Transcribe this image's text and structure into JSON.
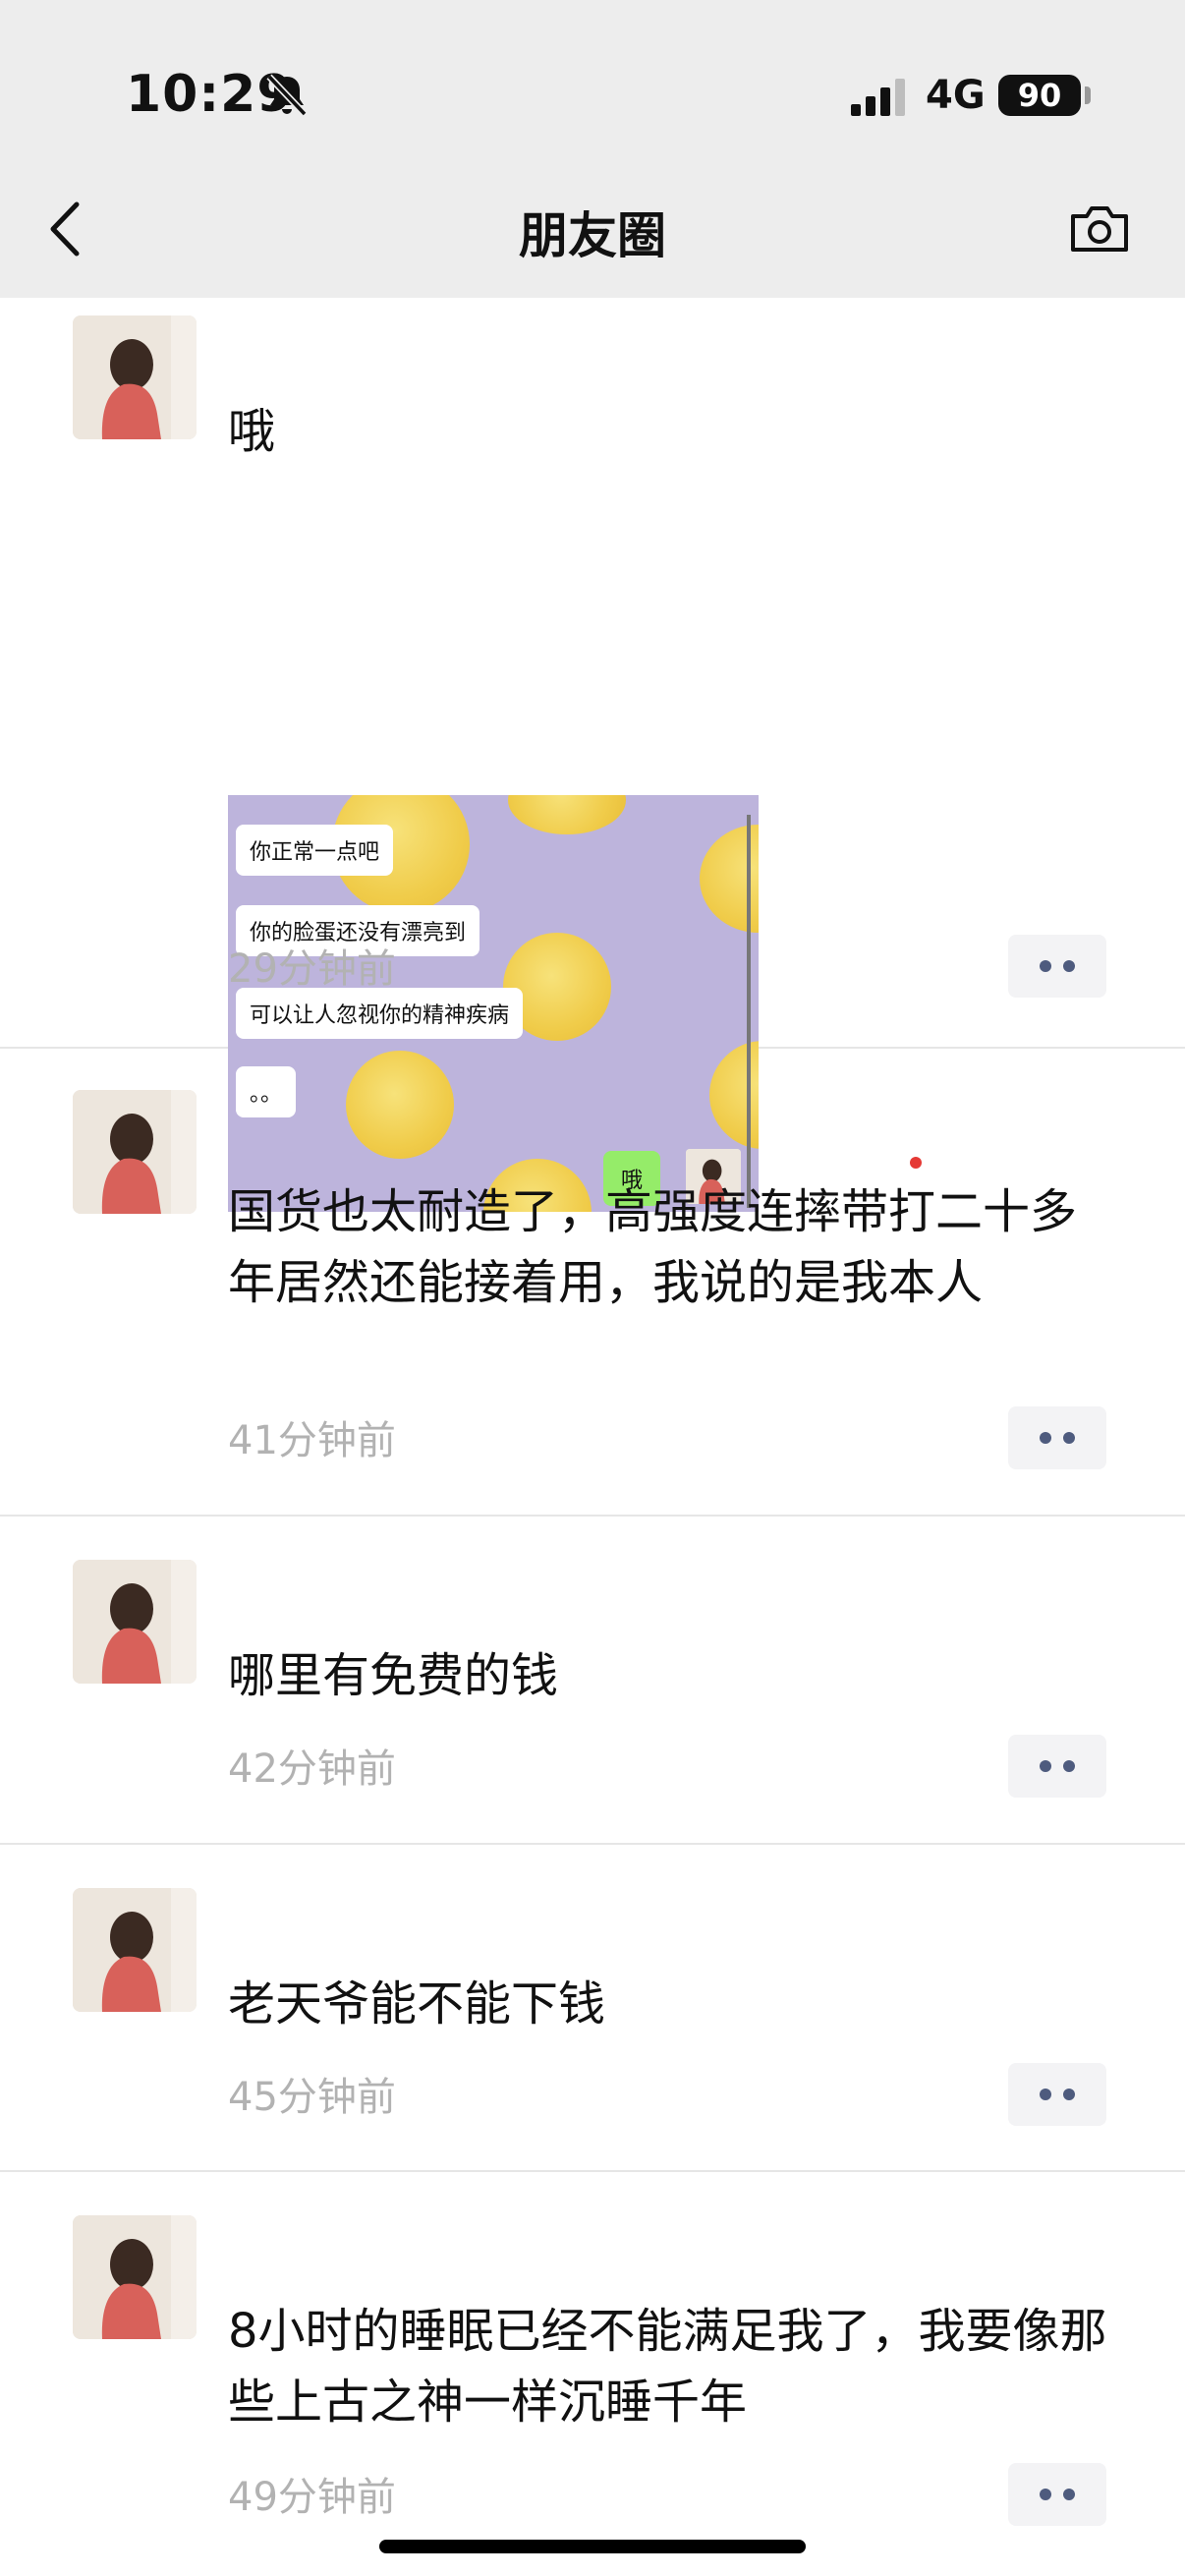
{
  "status_bar": {
    "time": "10:29",
    "network": "4G",
    "battery": "90"
  },
  "nav": {
    "title": "朋友圈"
  },
  "posts": [
    {
      "text": "哦",
      "time": "29分钟前",
      "image": {
        "bubbles": [
          "你正常一点吧",
          "你的脸蛋还没有漂亮到",
          "可以让人忽视你的精神疾病",
          "。。"
        ],
        "reply": "哦"
      }
    },
    {
      "text": "国货也太耐造了，高强度连摔带打二十多年居然还能接着用，我说的是我本人",
      "time": "41分钟前"
    },
    {
      "text": "哪里有免费的钱",
      "time": "42分钟前"
    },
    {
      "text": "老天爷能不能下钱",
      "time": "45分钟前"
    },
    {
      "text": "8小时的睡眠已经不能满足我了，我要像那些上古之神一样沉睡千年",
      "time": "49分钟前"
    }
  ],
  "colors": {
    "header_bg": "#ededed",
    "time_gray": "#b2b2b2",
    "more_dots": "#4e5b7e",
    "chat_green": "#95ec69"
  },
  "icons": [
    "bell-slash-icon",
    "signal-icon",
    "back-chevron-icon",
    "camera-icon",
    "more-options-icon"
  ]
}
